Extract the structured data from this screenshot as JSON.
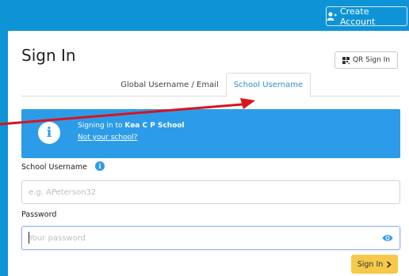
{
  "header": {
    "create_account_label": "Create Account"
  },
  "page": {
    "title": "Sign In",
    "qr_label": "QR Sign In"
  },
  "tabs": [
    {
      "label": "Global Username / Email",
      "active": false
    },
    {
      "label": "School Username",
      "active": true
    }
  ],
  "banner": {
    "prefix": "Signing in to ",
    "school_name": "Kea C P School",
    "not_your_school": "Not your school?"
  },
  "form": {
    "username_label": "School Username",
    "username_placeholder": "e.g. APeterson32",
    "password_label": "Password",
    "password_placeholder": "Your password",
    "signin_label": "Sign In"
  },
  "colors": {
    "brand_blue": "#0e94d6",
    "banner_blue": "#2d9ce8",
    "signin_yellow": "#f6c94a",
    "annotation_red": "#d9141b"
  },
  "icons": {
    "create_account": "add-user-icon",
    "qr": "qr-code-icon",
    "info": "info-icon",
    "help": "help-icon",
    "eye": "eye-icon",
    "signin": "chevron-right-icon"
  }
}
